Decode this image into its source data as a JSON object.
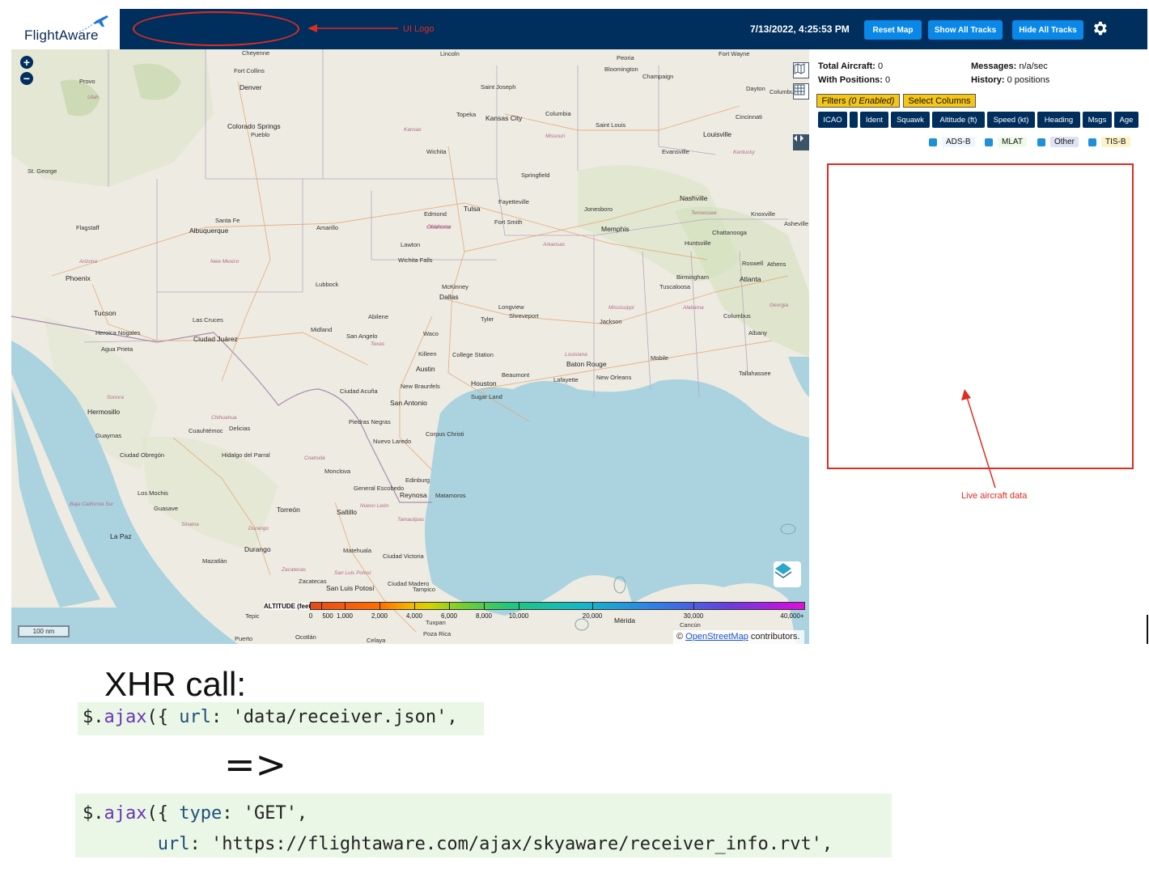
{
  "header": {
    "logo_text": "FlightAware",
    "logo_note": "UI Logo",
    "datetime": "7/13/2022, 4:25:53 PM",
    "reset_map": "Reset Map",
    "show_all_tracks": "Show All Tracks",
    "hide_all_tracks": "Hide All Tracks",
    "settings_icon": "gear-icon"
  },
  "map": {
    "zoom_in": "+",
    "zoom_out": "−",
    "scale_label": "100 nm",
    "attribution_prefix": "©",
    "attribution_link": "OpenStreetMap",
    "attribution_suffix": "contributors.",
    "altitude_legend": {
      "title": "ALTITUDE (feet)",
      "labels": [
        "0",
        "500",
        "1,000",
        "2,000",
        "4,000",
        "6,000",
        "8,000",
        "10,000",
        "20,000",
        "30,000",
        "40,000+"
      ]
    },
    "cities": [
      "Cheyenne",
      "Lincoln",
      "Peoria",
      "Fort Wayne",
      "Fort Collins",
      "Bloomington",
      "Champaign",
      "Denver",
      "Provo",
      "Saint Joseph",
      "Dayton",
      "Columbus",
      "Topeka",
      "Kansas City",
      "Columbia",
      "Cincinnati",
      "Colorado Springs",
      "Pueblo",
      "Saint Louis",
      "Louisville",
      "Wichita",
      "Evansville",
      "St. George",
      "Springfield",
      "Nashville",
      "Fayetteville",
      "Tulsa",
      "Edmond",
      "Oklahoma",
      "Fort Smith",
      "Jonesboro",
      "Knoxville",
      "Asheville",
      "Flagstaff",
      "Santa Fe",
      "Amarillo",
      "Memphis",
      "Albuquerque",
      "Lawton",
      "Chattanooga",
      "Huntsville",
      "Wichita Falls",
      "Roswell",
      "Athens",
      "Phoenix",
      "Lubbock",
      "Birmingham",
      "Atlanta",
      "McKinney",
      "Tuscaloosa",
      "Dallas",
      "Tucson",
      "Longview",
      "Tyler",
      "Shreveport",
      "Las Cruces",
      "Abilene",
      "Jackson",
      "Columbus",
      "Midland",
      "Albany",
      "Heroica Nogales",
      "Ciudad Juárez",
      "San Angelo",
      "Waco",
      "Agua Prieta",
      "Killeen",
      "College Station",
      "Mobile",
      "Baton Rouge",
      "Austin",
      "Tallahassee",
      "Beaumont",
      "Lafayette",
      "New Orleans",
      "New Braunfels",
      "Houston",
      "Ciudad Acuña",
      "San Antonio",
      "Sugar Land",
      "Hermosillo",
      "Piedras Negras",
      "Nuevo Laredo",
      "Corpus Christi",
      "Guaymas",
      "Cuauhtémoc",
      "Delicias",
      "Ciudad Obregón",
      "Hidalgo del Parral",
      "Monclova",
      "Edinburg",
      "Los Mochis",
      "General Escobedo",
      "Reynosa",
      "Matamoros",
      "Guasave",
      "Torreón",
      "Saltillo",
      "La Paz",
      "Durango",
      "Matehuala",
      "Ciudad Victoria",
      "Mazatlán",
      "Zacatecas",
      "San Luis Potosí",
      "Ciudad Madero",
      "Tampico",
      "Tepic",
      "Puerto",
      "Ocotlán",
      "Celaya",
      "Tuxpan",
      "Poza Rica",
      "Mérida",
      "Cancún"
    ],
    "states": [
      "Utah",
      "Kansas",
      "Missouri",
      "Kentucky",
      "Tennessee",
      "Oklahoma",
      "Arkansas",
      "Arizona",
      "New Mexico",
      "Texas",
      "Mississippi",
      "Alabama",
      "Georgia",
      "Louisiana",
      "Sonora",
      "Chihuahua",
      "Coahuila",
      "Nuevo León",
      "Tamaulipas",
      "Sinaloa",
      "Durango",
      "Zacatecas",
      "San Luis Potosí",
      "Baja California Sur"
    ]
  },
  "panel": {
    "total_aircraft_label": "Total Aircraft:",
    "total_aircraft_value": "0",
    "with_positions_label": "With Positions:",
    "with_positions_value": "0",
    "messages_label": "Messages:",
    "messages_value": "n/a/sec",
    "history_label": "History:",
    "history_value": "0 positions",
    "filters_label": "Filters",
    "filters_enabled": "(0 Enabled)",
    "select_columns": "Select Columns",
    "columns": [
      "ICAO",
      "",
      "Ident",
      "Squawk",
      "Altitude (ft)",
      "Speed (kt)",
      "Heading",
      "Msgs",
      "Age"
    ],
    "sources": [
      "ADS-B",
      "MLAT",
      "Other",
      "TIS-B"
    ],
    "live_note": "Live aircraft data"
  },
  "annotation": {
    "title": "XHR call:",
    "code1": {
      "prefix": "$.",
      "fn": "ajax",
      "mid": "({ ",
      "key": "url",
      "rest": ": 'data/receiver.json',"
    },
    "transform_arrow": "=>",
    "code2_line1": {
      "prefix": "$.",
      "fn": "ajax",
      "mid": "({ ",
      "key": "type",
      "rest": ": 'GET',"
    },
    "code2_line2": {
      "indent": "       ",
      "key": "url",
      "rest": ": 'https://flightaware.com/ajax/skyaware/receiver_info.rvt',"
    }
  },
  "colors": {
    "header_bg": "#002f5d",
    "button_blue": "#0a88e8",
    "filter_yellow": "#f5c518",
    "annotation_red": "#e02b20",
    "code_bg": "#eaf7e6"
  }
}
